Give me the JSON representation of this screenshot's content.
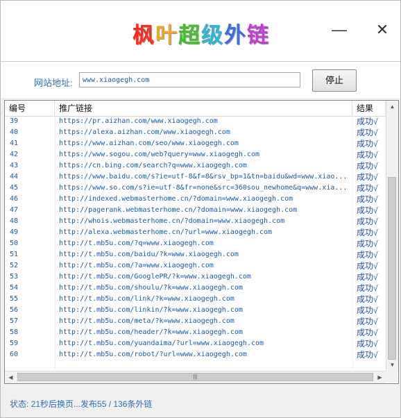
{
  "window": {
    "title_chars": [
      "枫",
      "叶",
      "超",
      "级",
      "外",
      "链"
    ],
    "title_colors": [
      "#ff2d1f",
      "#f5a623",
      "#46bf2f",
      "#2db7d8",
      "#3e6fe0",
      "#c13ed3"
    ],
    "minimize_icon": "minimize-icon",
    "close_icon": "close-icon"
  },
  "form": {
    "url_label": "网站地址:",
    "url_value": "www.xiaogegh.com",
    "stop_label": "停止"
  },
  "table": {
    "headers": [
      "编号",
      "推广链接",
      "结果"
    ],
    "rows": [
      [
        "39",
        "https://pr.aizhan.com/www.xiaogegh.com",
        "成功√"
      ],
      [
        "40",
        "https://alexa.aizhan.com/www.xiaogegh.com",
        "成功√"
      ],
      [
        "41",
        "https://www.aizhan.com/seo/www.xiaogegh.com",
        "成功√"
      ],
      [
        "42",
        "https://www.sogou.com/web?query=www.xiaogegh.com",
        "成功√"
      ],
      [
        "43",
        "https://cn.bing.com/search?q=www.xiaogegh.com",
        "成功√"
      ],
      [
        "44",
        "https://www.baidu.com/s?ie=utf-8&f=8&rsv_bp=1&tn=baidu&wd=www.xiao...",
        "成功√"
      ],
      [
        "45",
        "https://www.so.com/s?ie=utf-8&fr=none&src=360sou_newhome&q=www.xia...",
        "成功√"
      ],
      [
        "46",
        "http://indexed.webmasterhome.cn/?domain=www.xiaogegh.com",
        "成功√"
      ],
      [
        "47",
        "http://pagerank.webmasterhome.cn/?domain=www.xiaogegh.com",
        "成功√"
      ],
      [
        "48",
        "http://whois.webmasterhome.cn/?domain=www.xiaogegh.com",
        "成功√"
      ],
      [
        "49",
        "http://alexa.webmasterhome.cn/?url=www.xiaogegh.com",
        "成功√"
      ],
      [
        "50",
        "http://t.mb5u.com/?q=www.xiaogegh.com",
        "成功√"
      ],
      [
        "51",
        "http://t.mb5u.com/baidu/?k=www.xiaogegh.com",
        "成功√"
      ],
      [
        "52",
        "http://t.mb5u.com/?a=www.xiaogegh.com",
        "成功√"
      ],
      [
        "53",
        "http://t.mb5u.com/GooglePR/?k=www.xiaogegh.com",
        "成功√"
      ],
      [
        "54",
        "http://t.mb5u.com/shoulu/?k=www.xiaogegh.com",
        "成功√"
      ],
      [
        "55",
        "http://t.mb5u.com/link/?k=www.xiaogegh.com",
        "成功√"
      ],
      [
        "56",
        "http://t.mb5u.com/linkin/?k=www.xiaogegh.com",
        "成功√"
      ],
      [
        "57",
        "http://t.mb5u.com/meta/?k=www.xiaogegh.com",
        "成功√"
      ],
      [
        "58",
        "http://t.mb5u.com/header/?k=www.xiaogegh.com",
        "成功√"
      ],
      [
        "59",
        "http://t.mb5u.com/yuandaima/?url=www.xiaogegh.com",
        "成功√"
      ],
      [
        "60",
        "http://t.mb5u.com/robot/?url=www.xiaogegh.com",
        "成功√"
      ]
    ]
  },
  "status": {
    "text": "状态: 21秒后换页...发布55 / 136条外链"
  }
}
